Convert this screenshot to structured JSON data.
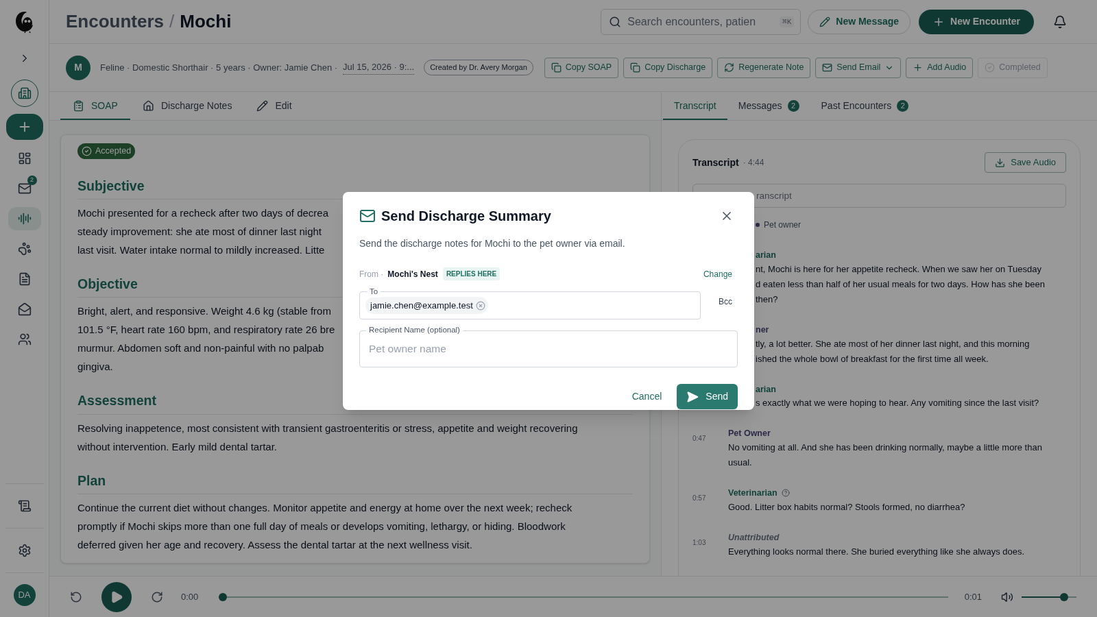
{
  "sidebar": {
    "items": [
      {
        "kind": "workspace",
        "selected": false
      },
      {
        "kind": "action",
        "selected": false
      },
      {
        "kind": "nav",
        "selected": false
      },
      {
        "kind": "nav",
        "selected": false,
        "badge": "2"
      },
      {
        "kind": "nav",
        "selected": true
      },
      {
        "kind": "nav",
        "selected": false
      },
      {
        "kind": "nav",
        "selected": false
      },
      {
        "kind": "nav",
        "selected": false
      },
      {
        "kind": "nav",
        "selected": false
      }
    ],
    "bottom_items": [
      {
        "selected": false
      },
      {
        "selected": false
      }
    ],
    "user_initials": "DA"
  },
  "header": {
    "breadcrumb": [
      "Encounters",
      "Mochi"
    ],
    "separator": "/",
    "search": {
      "placeholder": "Search encounters, patien",
      "shortcut": "⌘K"
    },
    "new_message": "New Message",
    "new_encounter": "New Encounter"
  },
  "patient": {
    "initial": "M",
    "meta": "Feline · Domestic Shorthair · 5 years · Owner: Jamie Chen ·",
    "date": "Jul 15, 2026 · 9:...",
    "created_by": "Created by Dr. Avery Morgan"
  },
  "actions": [
    {
      "label": "Copy SOAP",
      "disabled": false
    },
    {
      "label": "Copy Discharge",
      "disabled": false
    },
    {
      "label": "Regenerate Note",
      "disabled": false
    },
    {
      "label": "Send Email",
      "disabled": false,
      "menu": true
    },
    {
      "label": "Add Audio",
      "disabled": false
    },
    {
      "label": "Completed",
      "disabled": true
    }
  ],
  "note_tabs": [
    {
      "label": "SOAP",
      "selected": true
    },
    {
      "label": "Discharge Notes",
      "selected": false
    },
    {
      "label": "Edit",
      "selected": false
    }
  ],
  "note": {
    "status": "Accepted",
    "sections": [
      {
        "heading": "Subjective",
        "lines": [
          "Mochi presented for a recheck after two days of decrea",
          "steady improvement: she ate most of dinner last night",
          "last visit. Water intake normal to mildly increased. Litte"
        ]
      },
      {
        "heading": "Objective",
        "lines": [
          "Bright, alert, and responsive. Weight 4.6 kg (stable from",
          "101.5 °F, heart rate 160 bpm, and respiratory rate 26 bre",
          "murmur. Abdomen soft and non-painful with no palpab",
          "gingiva."
        ]
      },
      {
        "heading": "Assessment",
        "lines": [
          "Resolving inappetence, most consistent with transient gastroenteritis or stress, appetite and weight recovering",
          "without intervention. Early mild dental tartar."
        ]
      },
      {
        "heading": "Plan",
        "lines": [
          "Continue the current diet without changes. Monitor appetite and energy at home over the next week; recheck",
          "promptly if Mochi skips more than one full day of meals or develops vomiting, lethargy, or hiding. Bloodwork",
          "deferred given her age and recovery. Assess the dental tartar at the next wellness visit."
        ]
      }
    ]
  },
  "side_tabs": [
    {
      "label": "Transcript",
      "selected": true
    },
    {
      "label": "Messages",
      "selected": false,
      "badge": "2"
    },
    {
      "label": "Past Encounters",
      "selected": false,
      "badge": "2"
    }
  ],
  "transcript": {
    "title": "Transcript",
    "duration": "· 4:44",
    "save_audio": "Save Audio",
    "search_placeholder": "ranscript",
    "legend": [
      {
        "label": "Pet owner"
      }
    ],
    "entries": [
      {
        "kind": "vet",
        "speaker": "arian",
        "partial": true,
        "lines": [
          "nt, Mochi is here for her appetite recheck. When we saw her on Tuesday",
          "d eaten less than half of her usual meals for two days. How has she been",
          "then?"
        ]
      },
      {
        "kind": "owner",
        "speaker": "ner",
        "partial": true,
        "lines": [
          "tly, a lot better. She ate most of her dinner last night, and this morning",
          "ished the whole bowl of breakfast for the first time all week."
        ]
      },
      {
        "kind": "vet",
        "speaker": "arian",
        "partial": true,
        "lines": [
          "s exactly what we were hoping to hear. Any vomiting since the last visit?"
        ]
      },
      {
        "kind": "owner",
        "time": "0:47",
        "speaker": "Pet Owner",
        "partial": false,
        "lines": [
          "No vomiting at all. And she has been drinking normally, maybe a little more than usual."
        ]
      },
      {
        "kind": "vet",
        "time": "0:57",
        "speaker": "Veterinarian",
        "help": true,
        "partial": false,
        "lines": [
          "Good. Litter box habits normal? Stools formed, no diarrhea?"
        ]
      },
      {
        "kind": "unattributed",
        "time": "1:03",
        "speaker": "Unattributed",
        "partial": false,
        "lines": [
          "Everything looks normal there. She buried everything like she always does."
        ]
      }
    ]
  },
  "player": {
    "elapsed": "0:00",
    "total": "0:01",
    "level": 0,
    "volume": {
      "level": 0.83
    }
  },
  "dialog": {
    "title": "Send Discharge Summary",
    "description": "Send the discharge notes for Mochi to the pet owner via email.",
    "from_label": "From ·",
    "sender": "Mochi's Nest",
    "sender_badge": "REPLIES HERE",
    "change": "Change",
    "to_label": "To",
    "recipients": [
      "jamie.chen@example.test"
    ],
    "bcc": "Bcc",
    "name_label": "Recipient Name (optional)",
    "name_placeholder": "Pet owner name",
    "cancel": "Cancel",
    "send": "Send"
  }
}
